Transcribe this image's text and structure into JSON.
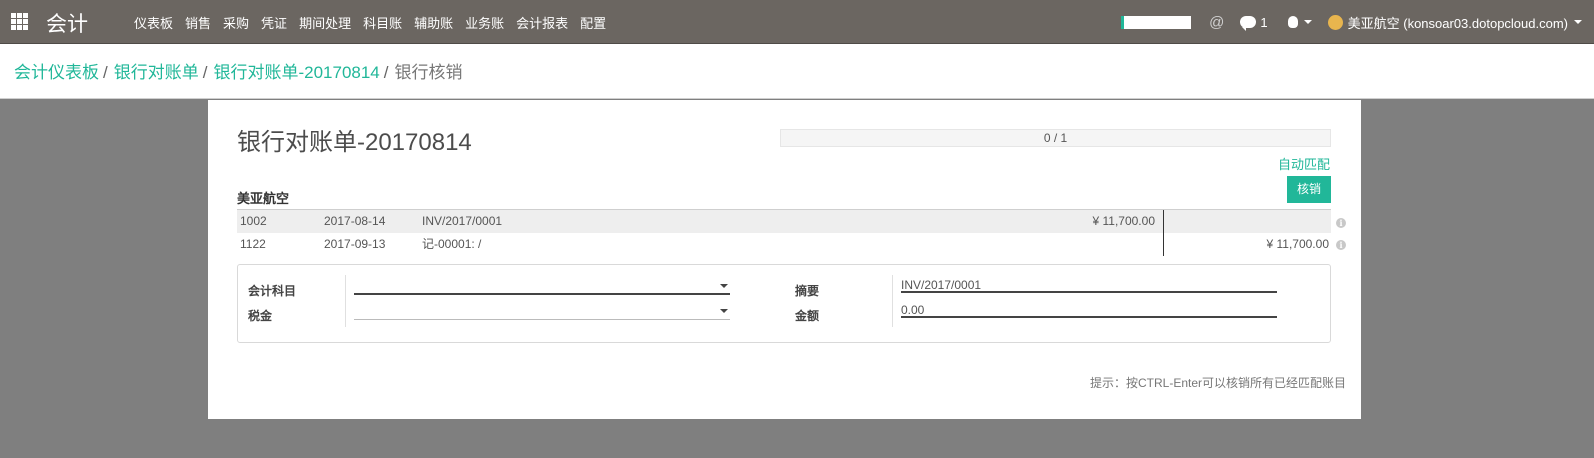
{
  "topbar": {
    "app_title": "会计",
    "menu": [
      "仪表板",
      "销售",
      "采购",
      "凭证",
      "期间处理",
      "科目账",
      "辅助账",
      "业务账",
      "会计报表",
      "配置"
    ],
    "at_symbol": "@",
    "message_count": "1",
    "user": "美亚航空 (konsoar03.dotopcloud.com)"
  },
  "breadcrumb": {
    "items": [
      "会计仪表板",
      "银行对账单",
      "银行对账单-20170814"
    ],
    "separator": "/",
    "current": "银行核销"
  },
  "statement": {
    "title": "银行对账单-20170814",
    "progress_text": "0 / 1",
    "progress_value": 0,
    "automatch_label": "自动匹配",
    "reconcile_label": "核销",
    "partner": "美亚航空"
  },
  "lines": [
    {
      "account": "1002",
      "date": "2017-08-14",
      "label": "INV/2017/0001",
      "debit": "¥ 11,700.00",
      "credit": ""
    },
    {
      "account": "1122",
      "date": "2017-09-13",
      "label": "记-00001: /",
      "debit": "",
      "credit": "¥ 11,700.00"
    }
  ],
  "create_form": {
    "account_label": "会计科目",
    "account_value": "",
    "tax_label": "税金",
    "tax_value": "",
    "memo_label": "摘要",
    "memo_value": "INV/2017/0001",
    "amount_label": "金额",
    "amount_value": "0.00"
  },
  "hint": "提示：按CTRL-Enter可以核销所有已经匹配账目",
  "colors": {
    "navbar": "#6b6661",
    "accent": "#21b799",
    "backdrop": "#7f7f7f"
  }
}
